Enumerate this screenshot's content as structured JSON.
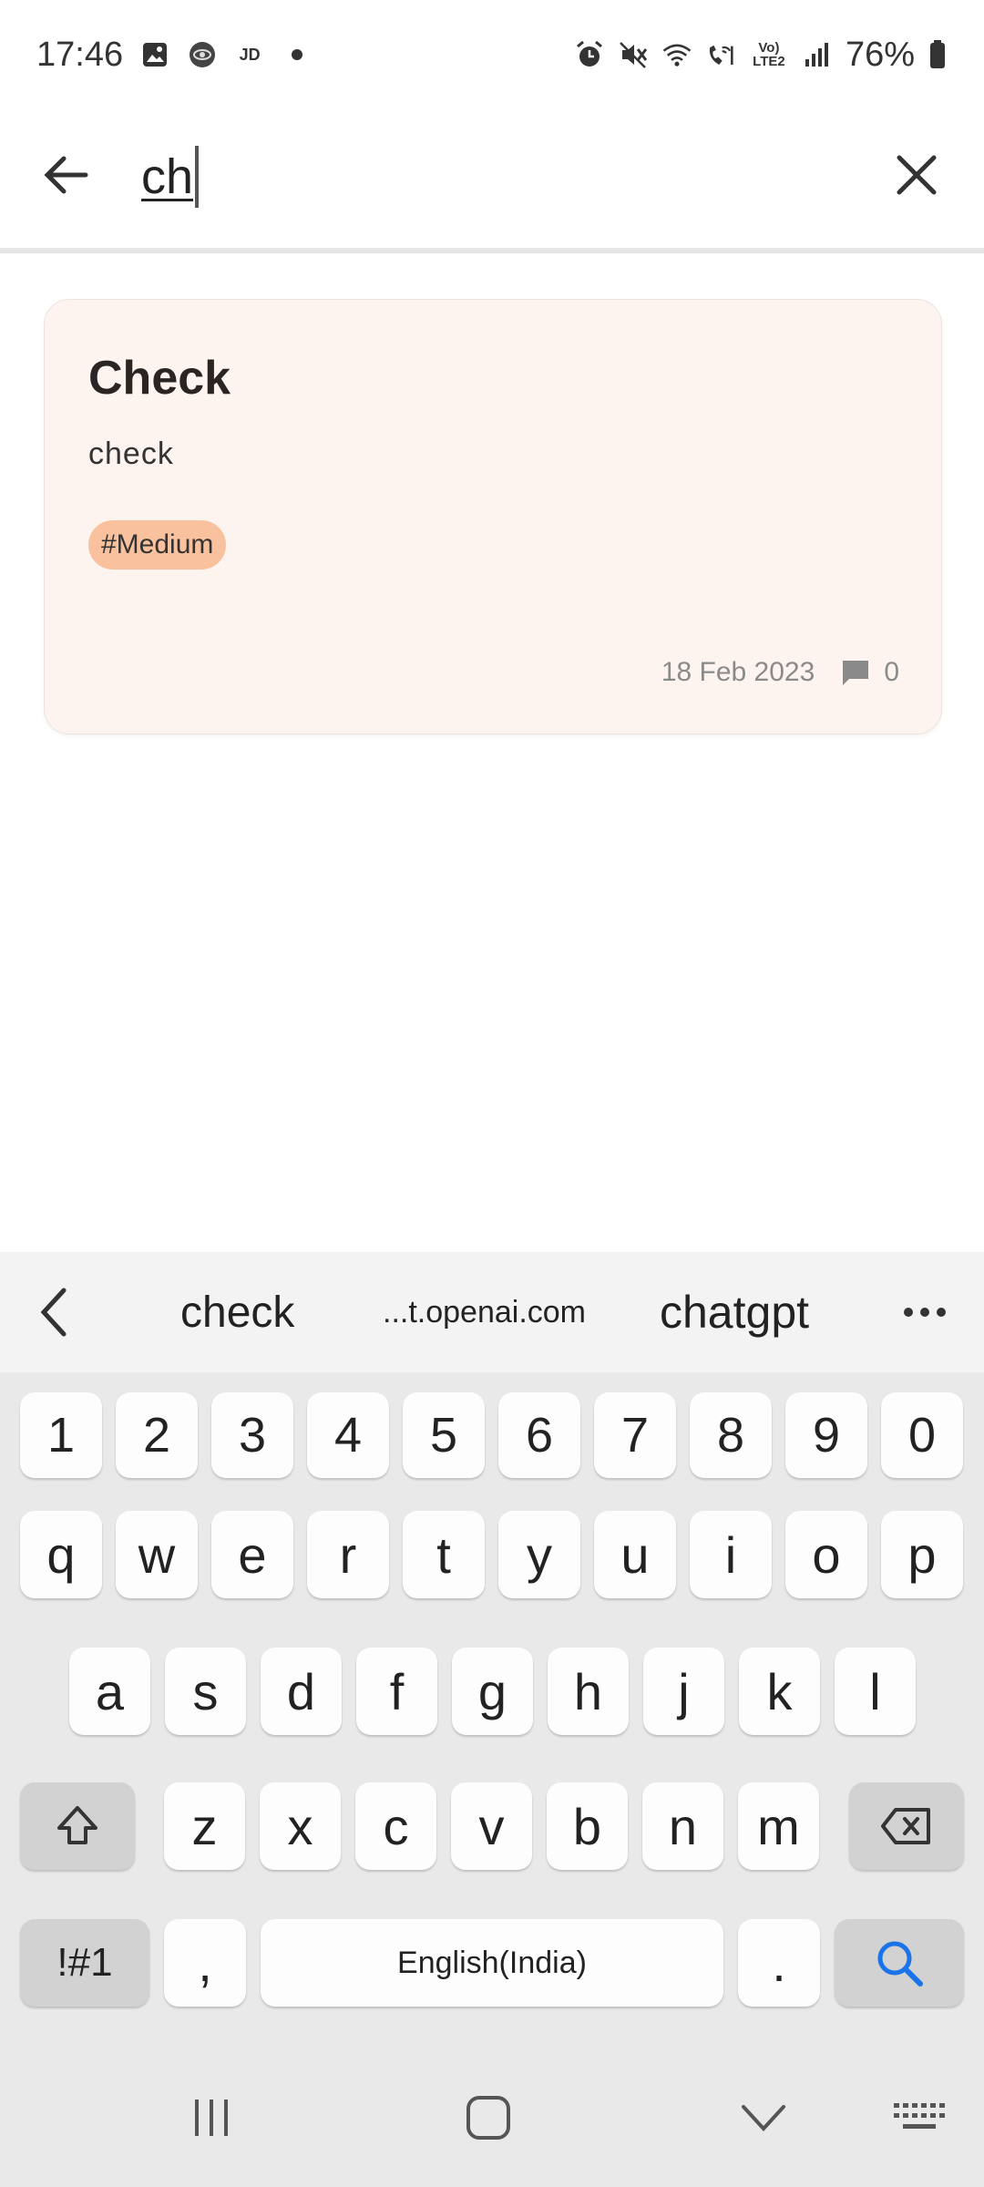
{
  "status_bar": {
    "time": "17:46",
    "left_icons": [
      "image-icon",
      "app-icon",
      "jd-icon",
      "dot-icon"
    ],
    "jd_text": "JD",
    "right_icons": [
      "alarm-icon",
      "mute-icon",
      "wifi-icon",
      "wifi-call-icon",
      "volte-icon",
      "signal-icon",
      "battery-icon"
    ],
    "volte_text": "Vo) LTE2",
    "battery": "76%"
  },
  "search": {
    "query": "ch"
  },
  "results": [
    {
      "title": "Check",
      "body": "check",
      "tag": "#Medium",
      "tag_color": "#f9c19d",
      "date": "18 Feb 2023",
      "comments": "0"
    }
  ],
  "keyboard": {
    "suggestions": [
      "check",
      "...t.openai.com",
      "chatgpt"
    ],
    "number_row": [
      "1",
      "2",
      "3",
      "4",
      "5",
      "6",
      "7",
      "8",
      "9",
      "0"
    ],
    "row1": [
      "q",
      "w",
      "e",
      "r",
      "t",
      "y",
      "u",
      "i",
      "o",
      "p"
    ],
    "row2": [
      "a",
      "s",
      "d",
      "f",
      "g",
      "h",
      "j",
      "k",
      "l"
    ],
    "row3": [
      "z",
      "x",
      "c",
      "v",
      "b",
      "n",
      "m"
    ],
    "symbols_label": "!#1",
    "comma": ",",
    "space_label": "English(India)",
    "period": ".",
    "search_key_color": "#1a73e8"
  }
}
